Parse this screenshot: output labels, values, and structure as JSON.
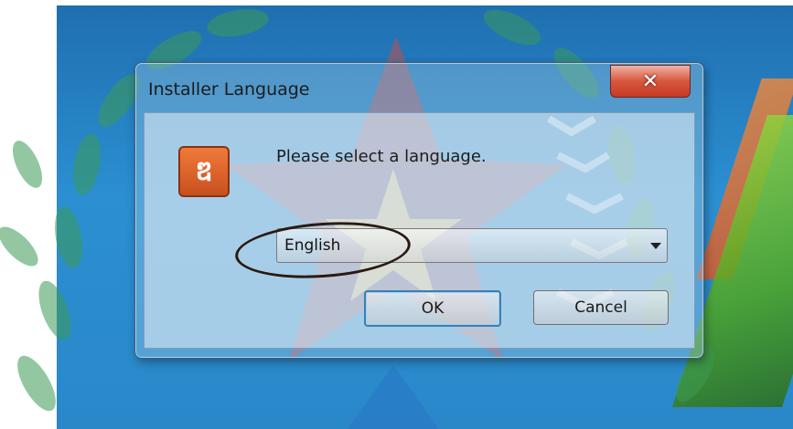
{
  "dialog": {
    "title": "Installer Language",
    "close_glyph": "✕",
    "icon": "xampp-app-icon",
    "icon_glyph": "ឌ",
    "prompt": "Please select a language.",
    "language_select": {
      "value": "English"
    },
    "ok_label": "OK",
    "cancel_label": "Cancel"
  },
  "colors": {
    "close_button": "#c63a24",
    "app_icon": "#e0662d",
    "desktop": "#2b8fd1",
    "ok_focus_border": "#3c7fb1"
  }
}
